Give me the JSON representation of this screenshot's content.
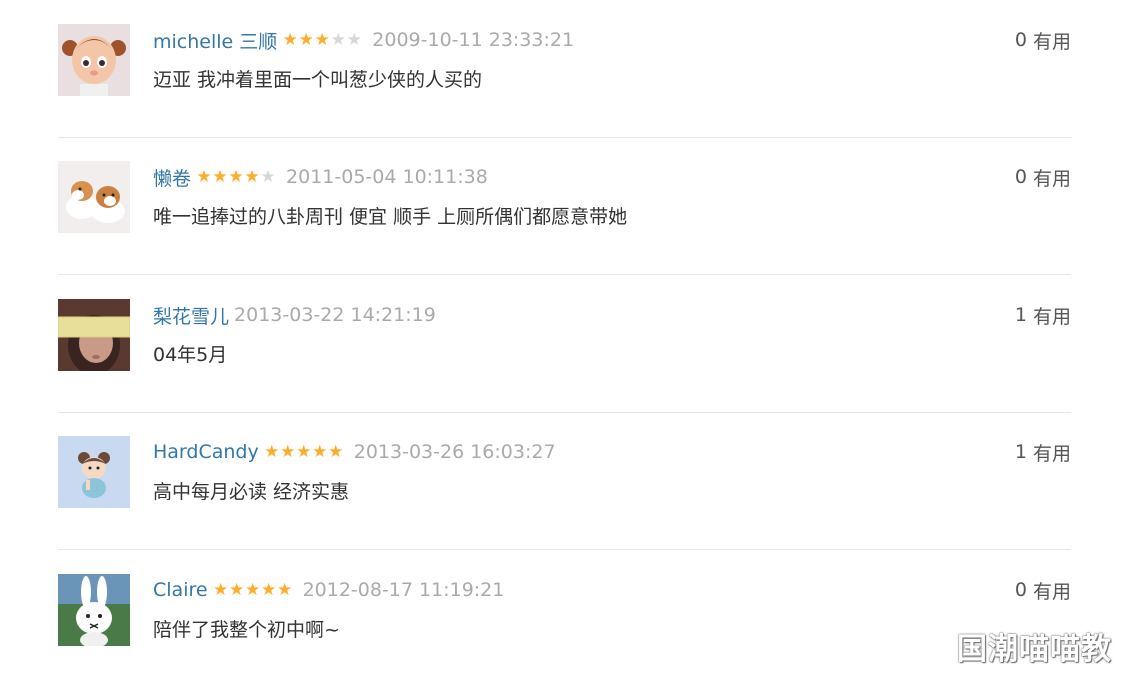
{
  "comments": [
    {
      "author": "michelle 三顺",
      "avatar": "cartoon-doll-avatar",
      "rating": 3,
      "time": "2009-10-11 23:33:21",
      "content": "迈亚 我冲着里面一个叫葱少侠的人买的",
      "votes": "0",
      "votes_label": "有用"
    },
    {
      "author": "懒卷",
      "avatar": "dogs-avatar",
      "rating": 4,
      "time": "2011-05-04 10:11:38",
      "content": "唯一追捧过的八卦周刊 便宜 顺手 上厕所偶们都愿意带她",
      "votes": "0",
      "votes_label": "有用"
    },
    {
      "author": "梨花雪儿",
      "avatar": "girl-photo-avatar",
      "rating": 0,
      "time": "2013-03-22 14:21:19",
      "content": "04年5月",
      "votes": "1",
      "votes_label": "有用"
    },
    {
      "author": "HardCandy",
      "avatar": "cartoon-girl-avatar",
      "rating": 5,
      "time": "2013-03-26 16:03:27",
      "content": "高中每月必读 经济实惠",
      "votes": "1",
      "votes_label": "有用"
    },
    {
      "author": "Claire",
      "avatar": "rabbit-avatar",
      "rating": 5,
      "time": "2012-08-17 11:19:21",
      "content": "陪伴了我整个初中啊~",
      "votes": "0",
      "votes_label": "有用"
    }
  ],
  "watermark": "国潮喵喵教",
  "colors": {
    "author_link": "#3377aa",
    "star_on": "#ffac2d",
    "star_off": "#d8d8d8",
    "time": "#aaaaaa",
    "content": "#333333"
  }
}
